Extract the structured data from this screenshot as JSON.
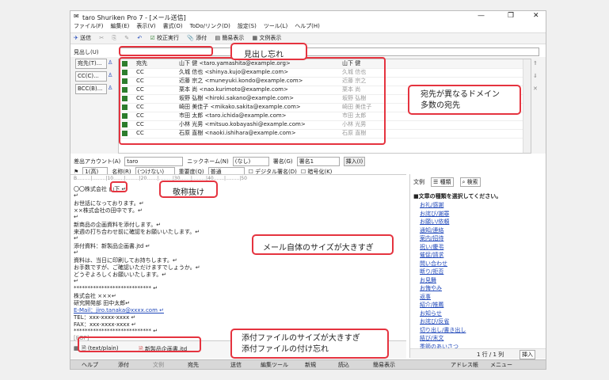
{
  "app": {
    "title": "taro Shuriken Pro 7 - [メール送信]",
    "menu": [
      "ファイル(F)",
      "編集(E)",
      "表示(V)",
      "書式(O)",
      "ToDo/リンク(D)",
      "設定(S)",
      "ツール(L)",
      "ヘルプ(H)"
    ],
    "toolbar": [
      "送信",
      "校正実行",
      "添付",
      "簡易表示",
      "文例表示"
    ],
    "window_controls": [
      "—",
      "❐",
      "✕"
    ]
  },
  "subject": {
    "label": "見出し(U)",
    "value": ""
  },
  "recipient_buttons": [
    "宛先(T)...",
    "CC(C)...",
    "BCC(B)..."
  ],
  "recipients": [
    {
      "type": "宛先",
      "address": "山下 健 <taro.yamashita@example.org>",
      "name": "山下 健"
    },
    {
      "type": "CC",
      "address": "久城 信也 <shinya.kujo@example.com>",
      "name": "久城 信也"
    },
    {
      "type": "CC",
      "address": "近藤 宗之 <muneyuki.kondo@example.com>",
      "name": "近藤 宗之"
    },
    {
      "type": "CC",
      "address": "栗本 尚 <nao.kurimoto@example.com>",
      "name": "栗本 尚"
    },
    {
      "type": "CC",
      "address": "坂野 弘樹 <hiroki.sakano@example.com>",
      "name": "坂野 弘樹"
    },
    {
      "type": "CC",
      "address": "崎田 美佳子 <mikako.sakita@example.com>",
      "name": "崎田 美佳子"
    },
    {
      "type": "CC",
      "address": "市田 太郎 <taro.ichida@example.com>",
      "name": "市田 太郎"
    },
    {
      "type": "CC",
      "address": "小林 光男 <mitsuo.kobayashi@example.com>",
      "name": "小林 光男"
    },
    {
      "type": "CC",
      "address": "石原 直樹 <naoki.ishihara@example.com>",
      "name": "石原 直樹"
    }
  ],
  "sender": {
    "label": "差出アカウント(A)",
    "account": "taro",
    "nickname_label": "ニックネーム(N)",
    "nickname": "(なし)",
    "signature_label": "署名(G)",
    "signature": "署名1",
    "insert_btn": "挿入(I)",
    "priority_label": "優先(P)",
    "priority": "1(高)",
    "title_label": "名称(R)",
    "title_value": "(つけない)",
    "format_label": "重要度(Q)",
    "format": "普通",
    "digital_sign": "デジタル署名(D)",
    "encrypt": "暗号化(K)"
  },
  "ruler": "B.........|.........|10.......|.........|20.......|.........|30.......|.........|40.......|.........|50",
  "body_lines": [
    "〇〇株式会社 山下 ↵",
    "↵",
    "お世話になっております。↵",
    "××株式会社の田中です。↵",
    "↵",
    "新商品の企画資料を添付します。↵",
    "来週の打ち合わせ前に確認をお願いいたします。↵",
    "↵",
    "添付資料：新製品企画書.jtd ↵",
    "↵",
    "資料は、当日に印刷してお持ちします。↵",
    "お手数ですが、ご確認いただけますでしょうか。↵",
    "どうぞよろしくお願いいたします。↵",
    "↵",
    "**************************** ↵",
    "株式会社 ×××↵",
    "研究開発部 田中太郎↵",
    "E-Mail：jiro.tanaka@xxxx.com ↵",
    "TEL：xxx-xxxx-xxxx ↵",
    "FAX：xxx-xxxx-xxxx ↵",
    "**************************** ↵",
    "[EOF]"
  ],
  "attachments": [
    {
      "label": "(text/plain)"
    },
    {
      "label": "新製品企画書.jtd"
    }
  ],
  "right_panel": {
    "tabs": [
      "文例",
      "種類",
      "検索"
    ],
    "heading": "■文章の種類を選択してください。",
    "items": [
      "お礼/感謝",
      "お詫び/謝罪",
      "お願い/依頼",
      "通知/連絡",
      "案内/招待",
      "祝い/慶弔",
      "催促/請求",
      "問い合わせ",
      "断り/拒否",
      "お見舞",
      "お悔やみ",
      "返事",
      "紹介/推薦",
      "お知らせ",
      "お詫び/反省",
      "切り出し/書き出し",
      "結び/末文",
      "季節のあいさつ"
    ],
    "status": "1 行 / 1 列",
    "insert": "挿入"
  },
  "statusbar": [
    "ヘルプ",
    "添付",
    "文例",
    "宛先",
    "送信",
    "編集ツール",
    "新規",
    "読込",
    "簡易表示",
    "アドレス帳",
    "メニュー"
  ],
  "callouts": {
    "subject": "見出し忘れ",
    "recipients_1": "宛先が異なるドメイン",
    "recipients_2": "多数の宛先",
    "honorific": "敬称抜け",
    "size": "メール自体のサイズが大きすぎ",
    "attach_1": "添付ファイルのサイズが大きすぎ",
    "attach_2": "添付ファイルの付け忘れ"
  }
}
